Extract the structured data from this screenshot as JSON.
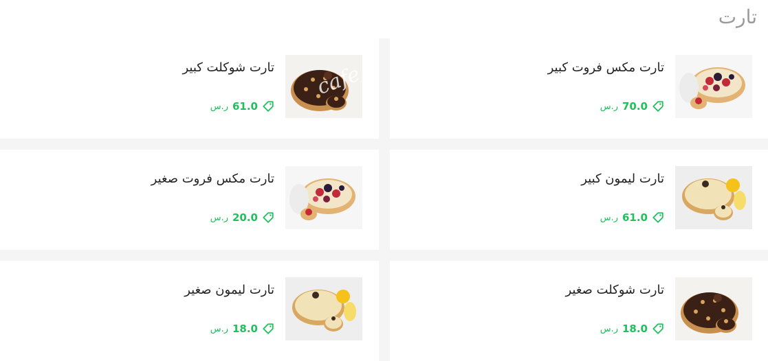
{
  "section": {
    "title": "تارت"
  },
  "watermark": "cafe.r",
  "currency_label": "ر.س",
  "colors": {
    "accent": "#20c05c",
    "title": "#9a9a9a"
  },
  "items": [
    {
      "name": "تارت مكس فروت كبير",
      "price": "70.0",
      "image": "mixed-fruit-tart"
    },
    {
      "name": "تارت شوكلت كبير",
      "price": "61.0",
      "image": "chocolate-tart"
    },
    {
      "name": "تارت ليمون كبير",
      "price": "61.0",
      "image": "lemon-tart"
    },
    {
      "name": "تارت مكس فروت صغير",
      "price": "20.0",
      "image": "mixed-fruit-tart"
    },
    {
      "name": "تارت شوكلت صغير",
      "price": "18.0",
      "image": "chocolate-tart"
    },
    {
      "name": "تارت ليمون صغير",
      "price": "18.0",
      "image": "lemon-tart"
    }
  ]
}
